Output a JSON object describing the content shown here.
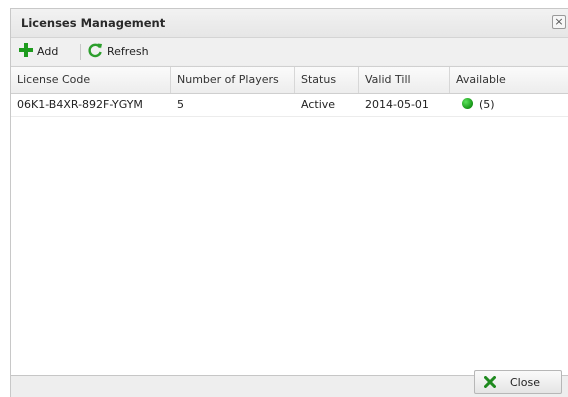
{
  "window": {
    "title": "Licenses Management",
    "close_glyph": "×"
  },
  "toolbar": {
    "add_label": "Add",
    "add_icon": "plus-icon",
    "refresh_label": "Refresh",
    "refresh_icon": "refresh-icon"
  },
  "grid": {
    "columns": [
      "License Code",
      "Number of Players",
      "Status",
      "Valid Till",
      "Available"
    ],
    "rows": [
      {
        "license_code": "06K1-B4XR-892F-YGYM",
        "players": "5",
        "status": "Active",
        "valid_till": "2014-05-01",
        "available_icon": "green-status-dot",
        "available": "(5)"
      }
    ]
  },
  "footer": {
    "close_label": "Close",
    "close_icon": "x-icon"
  },
  "colors": {
    "add_green": "#1e9b1e",
    "refresh_green": "#2c9e2c",
    "status_green": "#22aa22"
  }
}
